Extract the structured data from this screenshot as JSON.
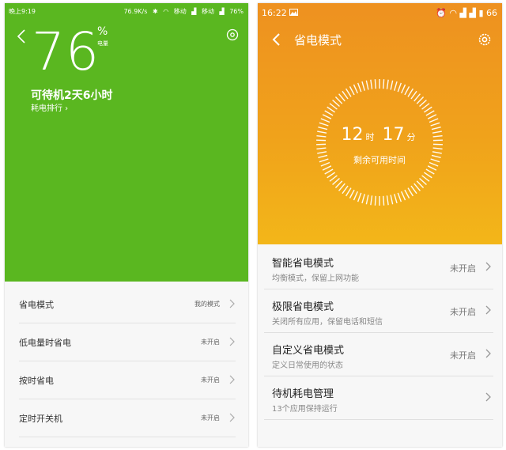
{
  "left": {
    "status": {
      "time": "晚上9:19",
      "speed": "76.9K/s",
      "carrier1": "移动",
      "carrier2": "移动",
      "battery": "76%"
    },
    "battery_value": "76",
    "percent_sign": "%",
    "percent_label": "电量",
    "standby": "可待机2天6小时",
    "usage_rank": "耗电排行 ›",
    "accent": "#5ab720",
    "items": [
      {
        "label": "省电模式",
        "status": "我的模式"
      },
      {
        "label": "低电量时省电",
        "status": "未开启"
      },
      {
        "label": "按时省电",
        "status": "未开启"
      },
      {
        "label": "定时开关机",
        "status": "未开启"
      }
    ]
  },
  "right": {
    "status": {
      "time": "16:22",
      "battery": "66"
    },
    "title": "省电模式",
    "hours": "12",
    "hours_unit": "时",
    "minutes": "17",
    "minutes_unit": "分",
    "remaining": "剩余可用时间",
    "accent": "#ef9a1e",
    "items": [
      {
        "label": "智能省电模式",
        "desc": "均衡模式，保留上网功能",
        "status": "未开启"
      },
      {
        "label": "极限省电模式",
        "desc": "关闭所有应用，保留电话和短信",
        "status": "未开启"
      },
      {
        "label": "自定义省电模式",
        "desc": "定义日常使用的状态",
        "status": "未开启"
      },
      {
        "label": "待机耗电管理",
        "desc": "13个应用保持运行",
        "status": ""
      }
    ]
  }
}
